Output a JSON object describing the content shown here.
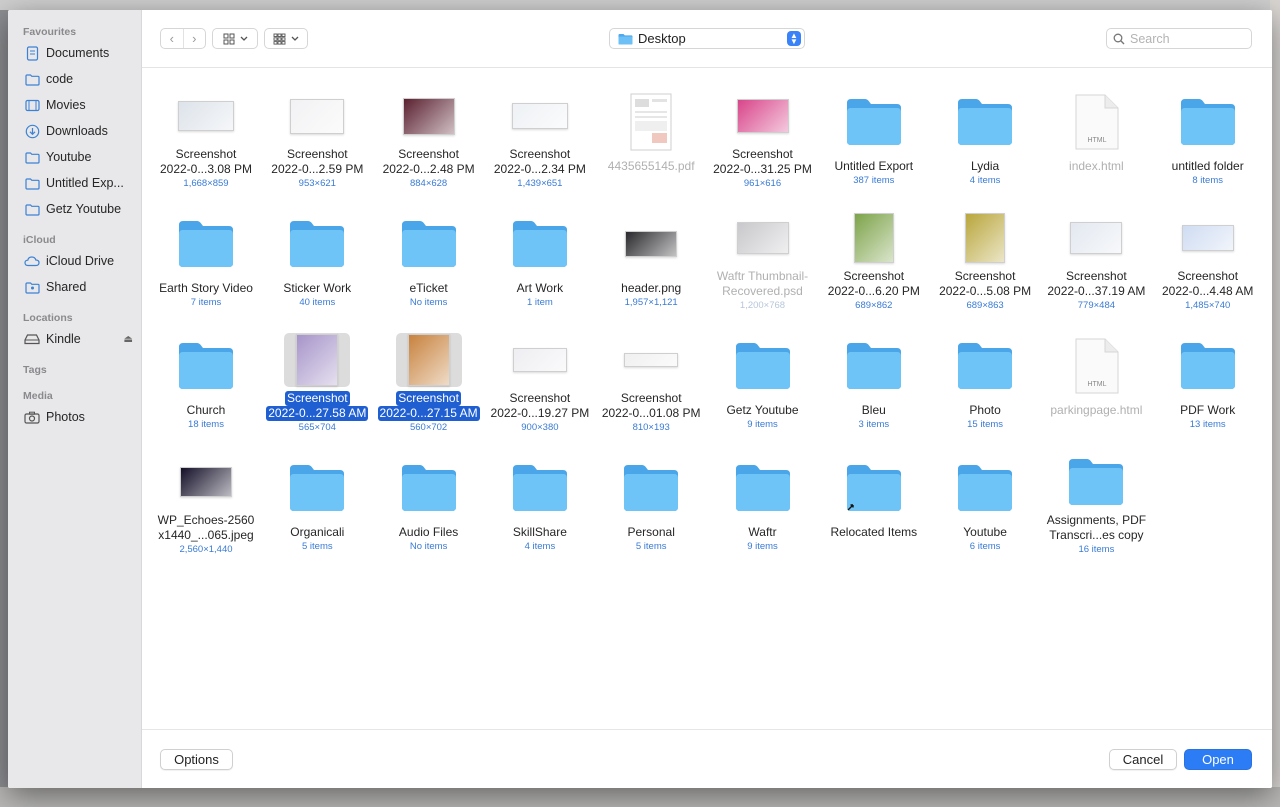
{
  "sidebar": {
    "sections": [
      {
        "title": "Favourites",
        "items": [
          {
            "label": "Documents",
            "icon": "document-folder-icon"
          },
          {
            "label": "code",
            "icon": "folder-icon"
          },
          {
            "label": "Movies",
            "icon": "film-icon"
          },
          {
            "label": "Downloads",
            "icon": "download-icon"
          },
          {
            "label": "Youtube",
            "icon": "folder-icon"
          },
          {
            "label": "Untitled Exp...",
            "icon": "folder-icon"
          },
          {
            "label": "Getz Youtube",
            "icon": "folder-icon"
          }
        ]
      },
      {
        "title": "iCloud",
        "items": [
          {
            "label": "iCloud Drive",
            "icon": "cloud-icon"
          },
          {
            "label": "Shared",
            "icon": "shared-folder-icon"
          }
        ]
      },
      {
        "title": "Locations",
        "items": [
          {
            "label": "Kindle",
            "icon": "drive-icon",
            "eject": "⏏"
          }
        ]
      },
      {
        "title": "Tags",
        "items": []
      },
      {
        "title": "Media",
        "items": [
          {
            "label": "Photos",
            "icon": "camera-icon"
          }
        ]
      }
    ]
  },
  "toolbar": {
    "location": "Desktop",
    "search_placeholder": "Search"
  },
  "files": [
    {
      "name": "Screenshot|2022-0...3.08 PM",
      "meta": "1,668×859",
      "kind": "shot",
      "w": 56,
      "h": 30,
      "tint": "#dde3ea"
    },
    {
      "name": "Screenshot|2022-0...2.59 PM",
      "meta": "953×621",
      "kind": "shot",
      "w": 54,
      "h": 35,
      "tint": "#f2f2f4"
    },
    {
      "name": "Screenshot|2022-0...2.48 PM",
      "meta": "884×628",
      "kind": "shot",
      "w": 52,
      "h": 37,
      "tint": "#5a2030"
    },
    {
      "name": "Screenshot|2022-0...2.34 PM",
      "meta": "1,439×651",
      "kind": "shot",
      "w": 56,
      "h": 26,
      "tint": "#eef1f5"
    },
    {
      "name": "4435655145.pdf",
      "meta": "",
      "kind": "pdf",
      "dim": true
    },
    {
      "name": "Screenshot|2022-0...31.25 PM",
      "meta": "961×616",
      "kind": "shot",
      "w": 52,
      "h": 34,
      "tint": "#d8458a"
    },
    {
      "name": "Untitled Export",
      "meta": "387 items",
      "kind": "folder"
    },
    {
      "name": "Lydia",
      "meta": "4 items",
      "kind": "folder"
    },
    {
      "name": "index.html",
      "meta": "",
      "kind": "html",
      "dim": true
    },
    {
      "name": "untitled folder",
      "meta": "8 items",
      "kind": "folder"
    },
    {
      "name": "Earth Story Video",
      "meta": "7 items",
      "kind": "folder"
    },
    {
      "name": "Sticker Work",
      "meta": "40 items",
      "kind": "folder"
    },
    {
      "name": "eTicket",
      "meta": "No items",
      "kind": "folder"
    },
    {
      "name": "Art Work",
      "meta": "1 item",
      "kind": "folder"
    },
    {
      "name": "header.png",
      "meta": "1,957×1,121",
      "kind": "shot",
      "w": 52,
      "h": 26,
      "tint": "#2a2a2e"
    },
    {
      "name": "Waftr Thumbnail-|Recovered.psd",
      "meta": "1,200×768",
      "kind": "shot",
      "w": 52,
      "h": 32,
      "tint": "#c8c8cc",
      "dim": true
    },
    {
      "name": "Screenshot|2022-0...6.20 PM",
      "meta": "689×862",
      "kind": "shot",
      "w": 40,
      "h": 50,
      "tint": "#7da34a"
    },
    {
      "name": "Screenshot|2022-0...5.08 PM",
      "meta": "689×863",
      "kind": "shot",
      "w": 40,
      "h": 50,
      "tint": "#b9a63c"
    },
    {
      "name": "Screenshot|2022-0...37.19 AM",
      "meta": "779×484",
      "kind": "shot",
      "w": 52,
      "h": 32,
      "tint": "#e3e8f0"
    },
    {
      "name": "Screenshot|2022-0...4.48 AM",
      "meta": "1,485×740",
      "kind": "shot",
      "w": 52,
      "h": 26,
      "tint": "#cfdcf2"
    },
    {
      "name": "Church",
      "meta": "18 items",
      "kind": "folder"
    },
    {
      "name": "Screenshot|2022-0...27.58 AM",
      "meta": "565×704",
      "kind": "shot",
      "w": 42,
      "h": 52,
      "tint": "#a694c9",
      "sel": true
    },
    {
      "name": "Screenshot|2022-0...27.15 AM",
      "meta": "560×702",
      "kind": "shot",
      "w": 42,
      "h": 52,
      "tint": "#c8823e",
      "sel": true
    },
    {
      "name": "Screenshot|2022-0...19.27 PM",
      "meta": "900×380",
      "kind": "shot",
      "w": 54,
      "h": 24,
      "tint": "#eeeef2"
    },
    {
      "name": "Screenshot|2022-0...01.08 PM",
      "meta": "810×193",
      "kind": "shot",
      "w": 54,
      "h": 14,
      "tint": "#f0f0f0"
    },
    {
      "name": "Getz Youtube",
      "meta": "9 items",
      "kind": "folder"
    },
    {
      "name": "Bleu",
      "meta": "3 items",
      "kind": "folder"
    },
    {
      "name": "Photo",
      "meta": "15 items",
      "kind": "folder"
    },
    {
      "name": "parkingpage.html",
      "meta": "",
      "kind": "html",
      "dim": true
    },
    {
      "name": "PDF Work",
      "meta": "13 items",
      "kind": "folder"
    },
    {
      "name": "WP_Echoes-2560|x1440_...065.jpeg",
      "meta": "2,560×1,440",
      "kind": "shot",
      "w": 52,
      "h": 30,
      "tint": "#140f28"
    },
    {
      "name": "Organicali",
      "meta": "5 items",
      "kind": "folder"
    },
    {
      "name": "Audio Files",
      "meta": "No items",
      "kind": "folder"
    },
    {
      "name": "SkillShare",
      "meta": "4 items",
      "kind": "folder"
    },
    {
      "name": "Personal",
      "meta": "5 items",
      "kind": "folder"
    },
    {
      "name": "Waftr",
      "meta": "9 items",
      "kind": "folder"
    },
    {
      "name": "Relocated Items",
      "meta": "",
      "kind": "alias-folder"
    },
    {
      "name": "Youtube",
      "meta": "6 items",
      "kind": "folder"
    },
    {
      "name": "Assignments, PDF|Transcri...es copy",
      "meta": "16 items",
      "kind": "folder"
    }
  ],
  "footer": {
    "options_label": "Options",
    "cancel_label": "Cancel",
    "open_label": "Open"
  },
  "colors": {
    "accent": "#2c7cf6",
    "folder": "#5bb4f2",
    "selection": "#1f5fd2"
  }
}
